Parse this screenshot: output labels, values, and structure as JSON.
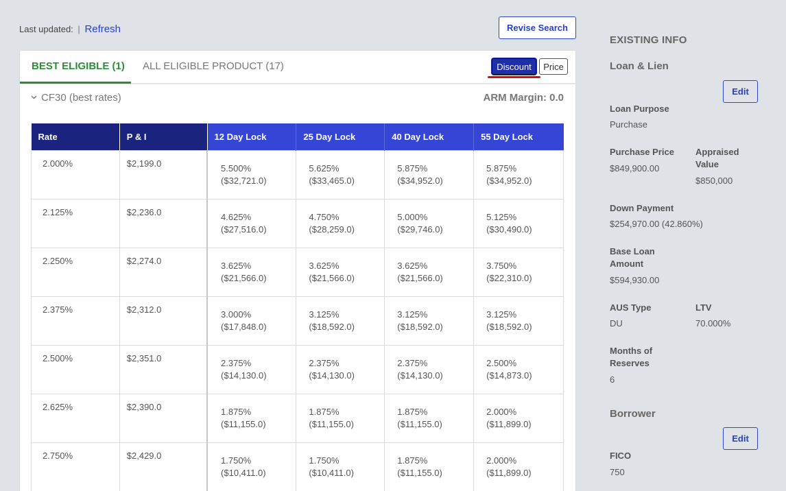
{
  "header": {
    "last_updated_label": "Last updated:",
    "separator": "|",
    "refresh_label": "Refresh",
    "revise_search_label": "Revise Search"
  },
  "tabs": {
    "best": "BEST ELIGIBLE (1)",
    "all": "ALL ELIGIBLE PRODUCT (17)"
  },
  "view_toggle": {
    "discount": "Discount",
    "price": "Price",
    "selected": "Discount"
  },
  "product": {
    "name": "CF30 (best rates)",
    "arm_margin": "ARM Margin: 0.0"
  },
  "table": {
    "headers": [
      "Rate",
      "P & I",
      "12 Day Lock",
      "25 Day Lock",
      "40 Day Lock",
      "55 Day Lock"
    ],
    "rows": [
      {
        "rate": "2.000%",
        "pi": "$2,199.0",
        "locks": [
          [
            "5.500%",
            "($32,721.0)"
          ],
          [
            "5.625%",
            "($33,465.0)"
          ],
          [
            "5.875%",
            "($34,952.0)"
          ],
          [
            "5.875%",
            "($34,952.0)"
          ]
        ]
      },
      {
        "rate": "2.125%",
        "pi": "$2,236.0",
        "locks": [
          [
            "4.625%",
            "($27,516.0)"
          ],
          [
            "4.750%",
            "($28,259.0)"
          ],
          [
            "5.000%",
            "($29,746.0)"
          ],
          [
            "5.125%",
            "($30,490.0)"
          ]
        ]
      },
      {
        "rate": "2.250%",
        "pi": "$2,274.0",
        "locks": [
          [
            "3.625%",
            "($21,566.0)"
          ],
          [
            "3.625%",
            "($21,566.0)"
          ],
          [
            "3.625%",
            "($21,566.0)"
          ],
          [
            "3.750%",
            "($22,310.0)"
          ]
        ]
      },
      {
        "rate": "2.375%",
        "pi": "$2,312.0",
        "locks": [
          [
            "3.000%",
            "($17,848.0)"
          ],
          [
            "3.125%",
            "($18,592.0)"
          ],
          [
            "3.125%",
            "($18,592.0)"
          ],
          [
            "3.125%",
            "($18,592.0)"
          ]
        ]
      },
      {
        "rate": "2.500%",
        "pi": "$2,351.0",
        "locks": [
          [
            "2.375%",
            "($14,130.0)"
          ],
          [
            "2.375%",
            "($14,130.0)"
          ],
          [
            "2.375%",
            "($14,130.0)"
          ],
          [
            "2.500%",
            "($14,873.0)"
          ]
        ]
      },
      {
        "rate": "2.625%",
        "pi": "$2,390.0",
        "locks": [
          [
            "1.875%",
            "($11,155.0)"
          ],
          [
            "1.875%",
            "($11,155.0)"
          ],
          [
            "1.875%",
            "($11,155.0)"
          ],
          [
            "2.000%",
            "($11,899.0)"
          ]
        ]
      },
      {
        "rate": "2.750%",
        "pi": "$2,429.0",
        "locks": [
          [
            "1.750%",
            "($10,411.0)"
          ],
          [
            "1.750%",
            "($10,411.0)"
          ],
          [
            "1.875%",
            "($11,155.0)"
          ],
          [
            "2.000%",
            "($11,899.0)"
          ]
        ]
      }
    ]
  },
  "sidebar": {
    "title": "EXISTING INFO",
    "loan_section": "Loan & Lien",
    "edit_label": "Edit",
    "loan_purpose_label": "Loan Purpose",
    "loan_purpose": "Purchase",
    "purchase_price_label": "Purchase Price",
    "purchase_price": "$849,900.00",
    "appraised_value_label": "Appraised Value",
    "appraised_value": "$850,000",
    "down_payment_label": "Down Payment",
    "down_payment": "$254,970.00 (42.860%)",
    "base_loan_label": "Base Loan Amount",
    "base_loan": "$594,930.00",
    "aus_type_label": "AUS Type",
    "aus_type": "DU",
    "ltv_label": "LTV",
    "ltv": "70.000%",
    "reserves_label": "Months of Reserves",
    "reserves": "6",
    "borrower_section": "Borrower",
    "fico_label": "FICO",
    "fico": "750"
  },
  "colors": {
    "accent_blue": "#3546d6",
    "header_dark": "#1a237e",
    "green_tab": "#2e8b3a",
    "red_underline": "#d40e0e"
  }
}
